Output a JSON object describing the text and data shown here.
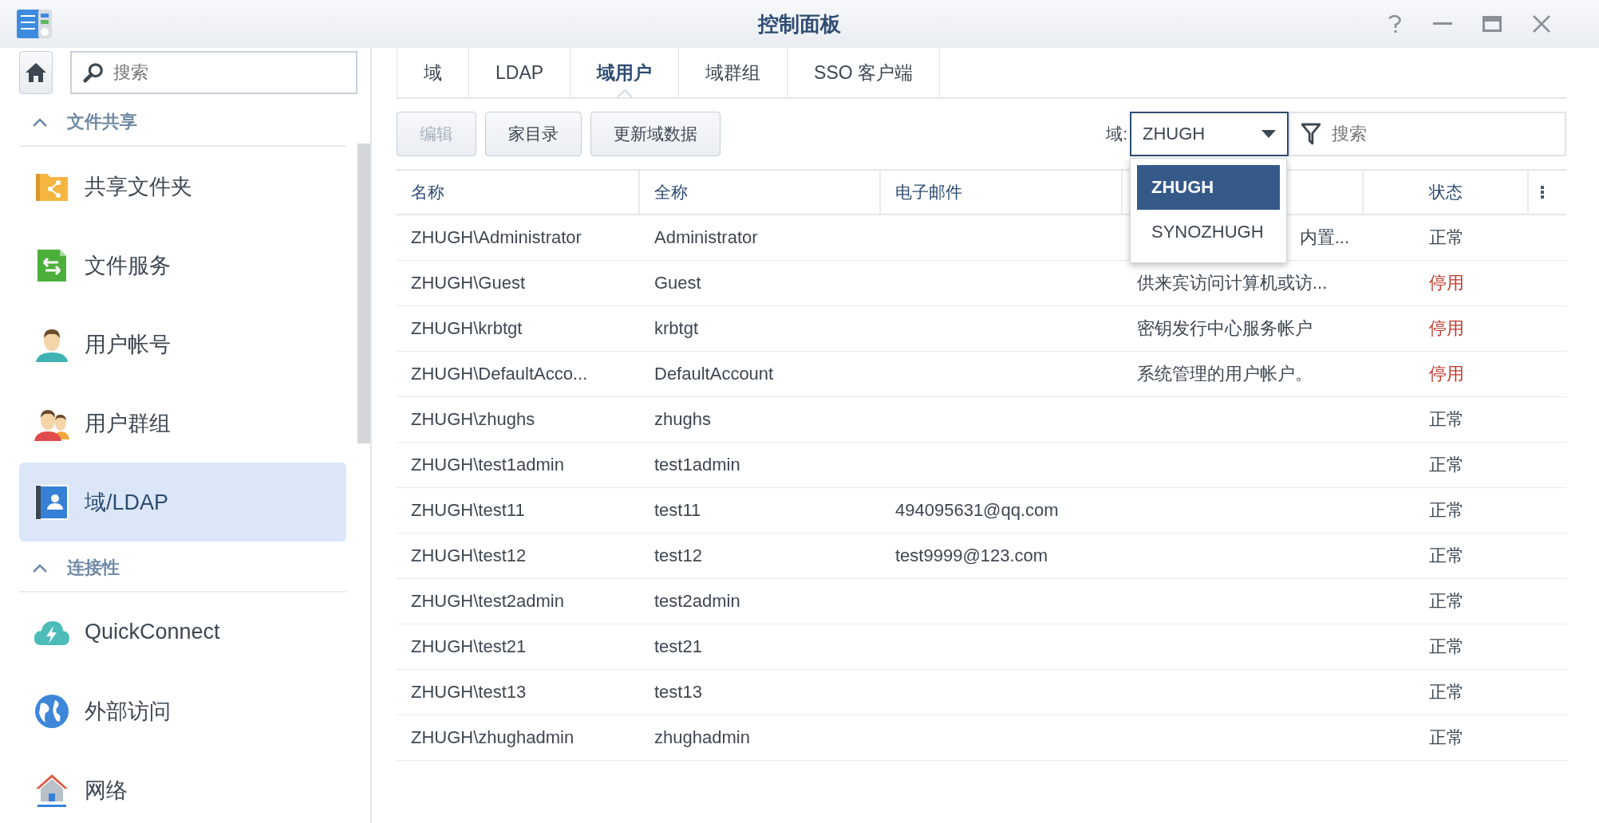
{
  "window": {
    "title": "控制面板"
  },
  "sidebar": {
    "search": {
      "placeholder": "搜索"
    },
    "sections": [
      {
        "title": "文件共享",
        "expanded": true,
        "items": [
          {
            "label": "共享文件夹",
            "kind": "folder",
            "selected": false
          },
          {
            "label": "文件服务",
            "kind": "file-service",
            "selected": false
          },
          {
            "label": "用户帐号",
            "kind": "user",
            "selected": false
          },
          {
            "label": "用户群组",
            "kind": "group",
            "selected": false
          },
          {
            "label": "域/LDAP",
            "kind": "directory",
            "selected": true
          }
        ]
      },
      {
        "title": "连接性",
        "expanded": true,
        "items": [
          {
            "label": "QuickConnect",
            "kind": "cloud",
            "selected": false
          },
          {
            "label": "外部访问",
            "kind": "globe",
            "selected": false
          },
          {
            "label": "网络",
            "kind": "network",
            "selected": false
          }
        ]
      }
    ]
  },
  "tabs": [
    {
      "label": "域",
      "selected": false
    },
    {
      "label": "LDAP",
      "selected": false
    },
    {
      "label": "域用户",
      "selected": true
    },
    {
      "label": "域群组",
      "selected": false
    },
    {
      "label": "SSO 客户端",
      "selected": false
    }
  ],
  "toolbar": {
    "buttons": [
      {
        "label": "编辑",
        "disabled": true
      },
      {
        "label": "家目录",
        "disabled": false
      },
      {
        "label": "更新域数据",
        "disabled": false
      }
    ],
    "domain_label": "域:",
    "domain_select": {
      "value": "ZHUGH",
      "open": true,
      "options": [
        {
          "label": "ZHUGH",
          "selected": true
        },
        {
          "label": "SYNOZHUGH",
          "selected": false
        }
      ]
    },
    "search": {
      "placeholder": "搜索"
    }
  },
  "table": {
    "columns": [
      {
        "label": "名称"
      },
      {
        "label": "全称"
      },
      {
        "label": "电子邮件"
      },
      {},
      {
        "label": "状态"
      }
    ],
    "rows": [
      {
        "name": "ZHUGH\\Administrator",
        "full_name": "Administrator",
        "description": "内置...",
        "status": "正常",
        "enabled": true
      },
      {
        "name": "ZHUGH\\Guest",
        "full_name": "Guest",
        "description": "供来宾访问计算机或访...",
        "status": "停用",
        "enabled": false
      },
      {
        "name": "ZHUGH\\krbtgt",
        "full_name": "krbtgt",
        "description": "密钥发行中心服务帐户",
        "status": "停用",
        "enabled": false
      },
      {
        "name": "ZHUGH\\DefaultAcco...",
        "full_name": "DefaultAccount",
        "description": "系统管理的用户帐户。",
        "status": "停用",
        "enabled": false
      },
      {
        "name": "ZHUGH\\zhughs",
        "full_name": "zhughs",
        "status": "正常",
        "enabled": true
      },
      {
        "name": "ZHUGH\\test1admin",
        "full_name": "test1admin",
        "status": "正常",
        "enabled": true
      },
      {
        "name": "ZHUGH\\test11",
        "full_name": "test11",
        "email": "494095631@qq.com",
        "status": "正常",
        "enabled": true
      },
      {
        "name": "ZHUGH\\test12",
        "full_name": "test12",
        "email": "test9999@123.com",
        "status": "正常",
        "enabled": true
      },
      {
        "name": "ZHUGH\\test2admin",
        "full_name": "test2admin",
        "status": "正常",
        "enabled": true
      },
      {
        "name": "ZHUGH\\test21",
        "full_name": "test21",
        "status": "正常",
        "enabled": true
      },
      {
        "name": "ZHUGH\\test13",
        "full_name": "test13",
        "status": "正常",
        "enabled": true
      },
      {
        "name": "ZHUGH\\zhughadmin",
        "full_name": "zhughadmin",
        "status": "正常",
        "enabled": true
      }
    ]
  }
}
